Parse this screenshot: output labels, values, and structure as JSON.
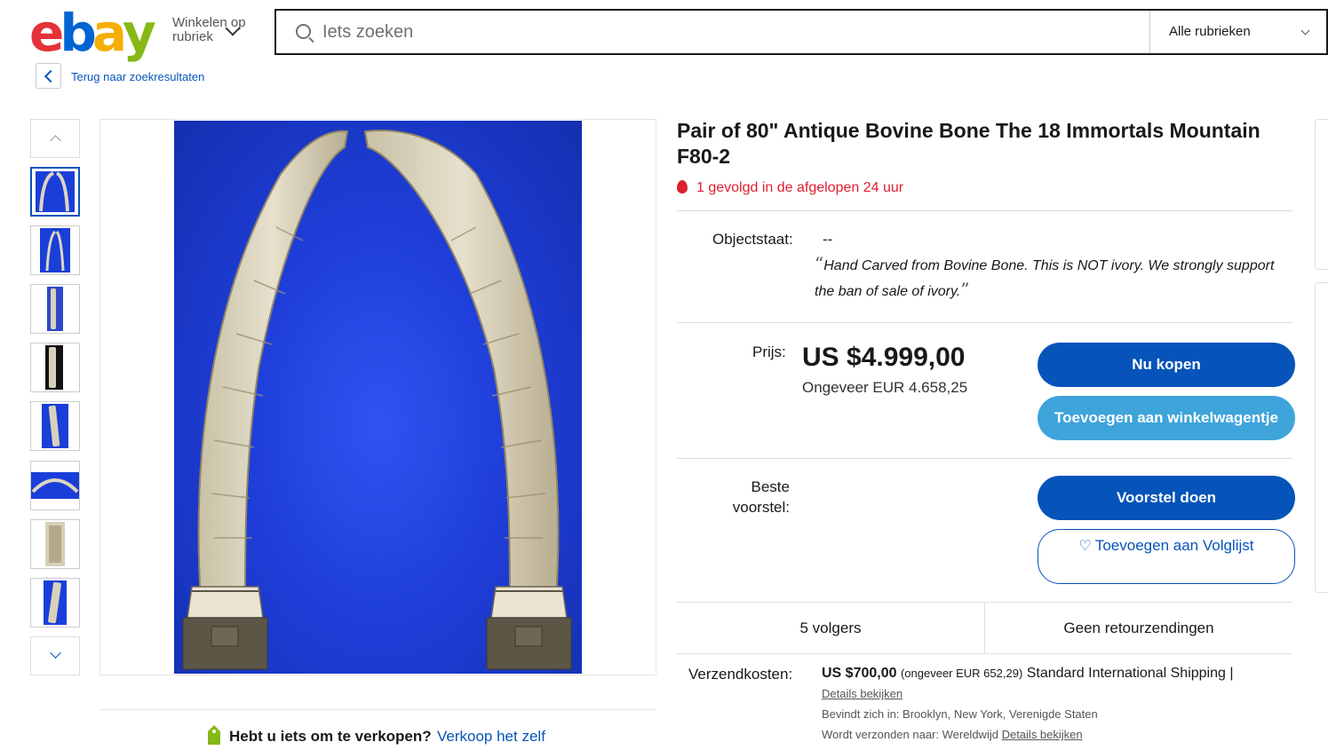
{
  "header": {
    "logo": {
      "e": "e",
      "b": "b",
      "a": "a",
      "y": "y"
    },
    "category_browse": "Winkelen op rubriek",
    "search": {
      "placeholder": "Iets zoeken",
      "value": ""
    },
    "category_select": "Alle rubrieken"
  },
  "nav": {
    "back_link": "Terug naar zoekresultaten"
  },
  "listing": {
    "title": "Pair of 80\" Antique Bovine Bone The 18 Immortals Mountain F80-2",
    "watching_hot": "1 gevolgd in de afgelopen 24 uur",
    "condition": {
      "label": "Objectstaat:",
      "value": "--",
      "description": "Hand Carved from Bovine Bone. This is NOT ivory. We strongly support the ban of sale of ivory."
    },
    "price": {
      "label": "Prijs:",
      "value": "US $4.999,00",
      "converted": "Ongeveer EUR 4.658,25"
    },
    "buttons": {
      "buy_now": "Nu kopen",
      "add_to_cart": "Toevoegen aan winkelwagentje",
      "make_offer": "Voorstel doen",
      "watchlist": "Toevoegen aan Volglijst"
    },
    "best_offer_label": "Beste voorstel:",
    "stats": {
      "watchers": "5 volgers",
      "returns": "Geen retourzendingen"
    },
    "shipping": {
      "label": "Verzendkosten:",
      "cost": "US $700,00",
      "cost_converted": "(ongeveer EUR 652,29)",
      "service": "Standard International Shipping |",
      "details_link": "Details bekijken",
      "located": "Bevindt zich in: Brooklyn, New York, Verenigde Staten",
      "ships_to_prefix": "Wordt verzonden naar: Wereldwijd",
      "ships_to_link": "Details bekijken"
    }
  },
  "sell": {
    "question": "Hebt u iets om te verkopen?",
    "link": "Verkoop het zelf"
  },
  "colors": {
    "accent": "#0654ba",
    "cart": "#3ea4da",
    "hot": "#dd1e31",
    "image_bg": "#1f3ed9"
  },
  "icons": [
    "search-icon",
    "chevron-down-icon",
    "chevron-left-icon",
    "chevron-up-icon",
    "flame-icon",
    "heart-icon",
    "price-tag-icon"
  ]
}
